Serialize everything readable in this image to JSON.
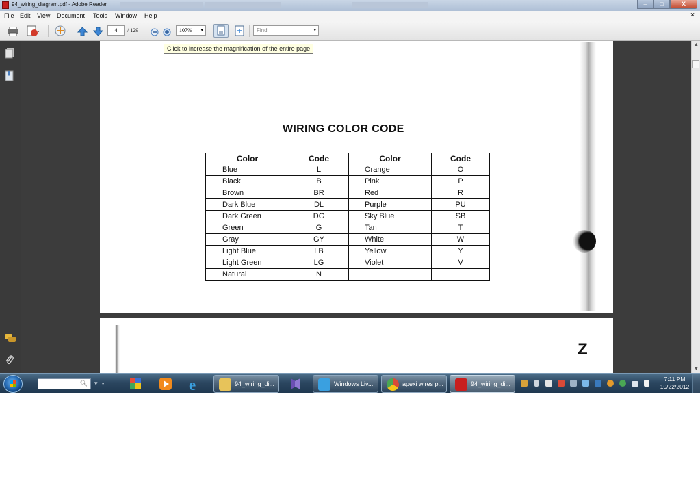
{
  "window": {
    "title": "94_wiring_diagram.pdf - Adobe Reader",
    "controls": {
      "minimize": "–",
      "maximize": "□",
      "close": "X"
    }
  },
  "menubar": {
    "items": [
      "File",
      "Edit",
      "View",
      "Document",
      "Tools",
      "Window",
      "Help"
    ],
    "close_doc": "×"
  },
  "toolbar": {
    "page_current": "4",
    "page_total": "/ 129",
    "zoom": "107%",
    "find_placeholder": "Find"
  },
  "tooltip": "Click to increase the magnification of the entire page",
  "document": {
    "title": "WIRING COLOR CODE",
    "headers": [
      "Color",
      "Code",
      "Color",
      "Code"
    ],
    "rows": [
      [
        "Blue",
        "L",
        "Orange",
        "O"
      ],
      [
        "Black",
        "B",
        "Pink",
        "P"
      ],
      [
        "Brown",
        "BR",
        "Red",
        "R"
      ],
      [
        "Dark Blue",
        "DL",
        "Purple",
        "PU"
      ],
      [
        "Dark Green",
        "DG",
        "Sky Blue",
        "SB"
      ],
      [
        "Green",
        "G",
        "Tan",
        "T"
      ],
      [
        "Gray",
        "GY",
        "White",
        "W"
      ],
      [
        "Light Blue",
        "LB",
        "Yellow",
        "Y"
      ],
      [
        "Light Green",
        "LG",
        "Violet",
        "V"
      ],
      [
        "Natural",
        "N",
        "",
        ""
      ]
    ],
    "page2_letter": "Z"
  },
  "taskbar": {
    "tasks": [
      {
        "label": "94_wiring_di...",
        "icon": "folder-icon",
        "color": "#e7c35a"
      },
      {
        "label": "Windows Liv...",
        "icon": "windows-live-icon",
        "color": "#3aa0e0"
      },
      {
        "label": "apexi wires p...",
        "icon": "chrome-icon",
        "color": "#d94a38"
      },
      {
        "label": "94_wiring_di...",
        "icon": "adobe-reader-icon",
        "color": "#c81e1e"
      }
    ],
    "clock_time": "7:11 PM",
    "clock_date": "10/22/2012"
  },
  "colors": {
    "accent": "#c81e1e",
    "taskbar": "#2b4660",
    "tooltip_bg": "#ffffe1"
  }
}
